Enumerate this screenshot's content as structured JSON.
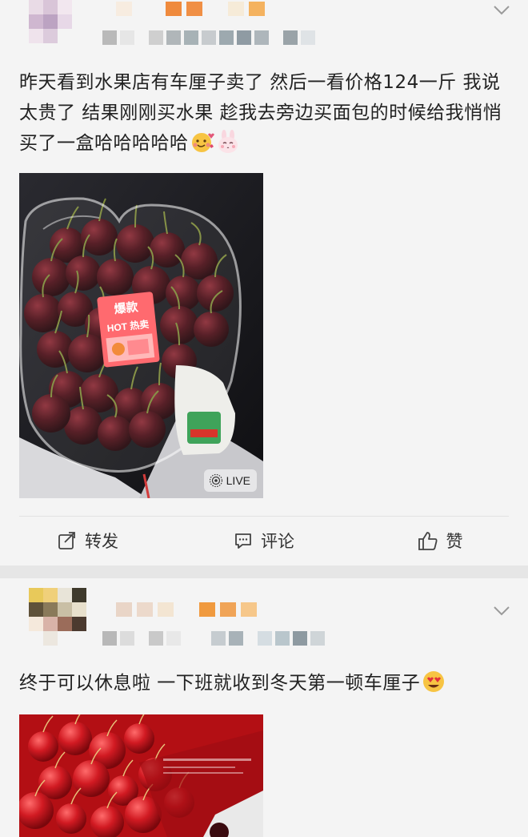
{
  "posts": [
    {
      "text": "昨天看到水果店有车厘子卖了 然后一看价格124一斤 我说太贵了 结果刚刚买水果 趁我去旁边买面包的时候给我悄悄买了一盒哈哈哈哈哈",
      "emojis": [
        "blush-love-emoji",
        "bunny-emoji"
      ],
      "photo": {
        "sticker_top": "爆款",
        "sticker_bottom": "HOT 热卖",
        "live_label": "LIVE"
      },
      "actions": {
        "repost": "转发",
        "comment": "评论",
        "like": "赞"
      }
    },
    {
      "text": "终于可以休息啦  一下班就收到冬天第一顿车厘子",
      "emojis": [
        "heart-eyes-emoji"
      ]
    }
  ],
  "colors": {
    "background": "#f4f4f4",
    "divider": "#e6e6e6",
    "text": "#222222",
    "cherry": "#4a0f17",
    "box_red": "#b30f14"
  }
}
